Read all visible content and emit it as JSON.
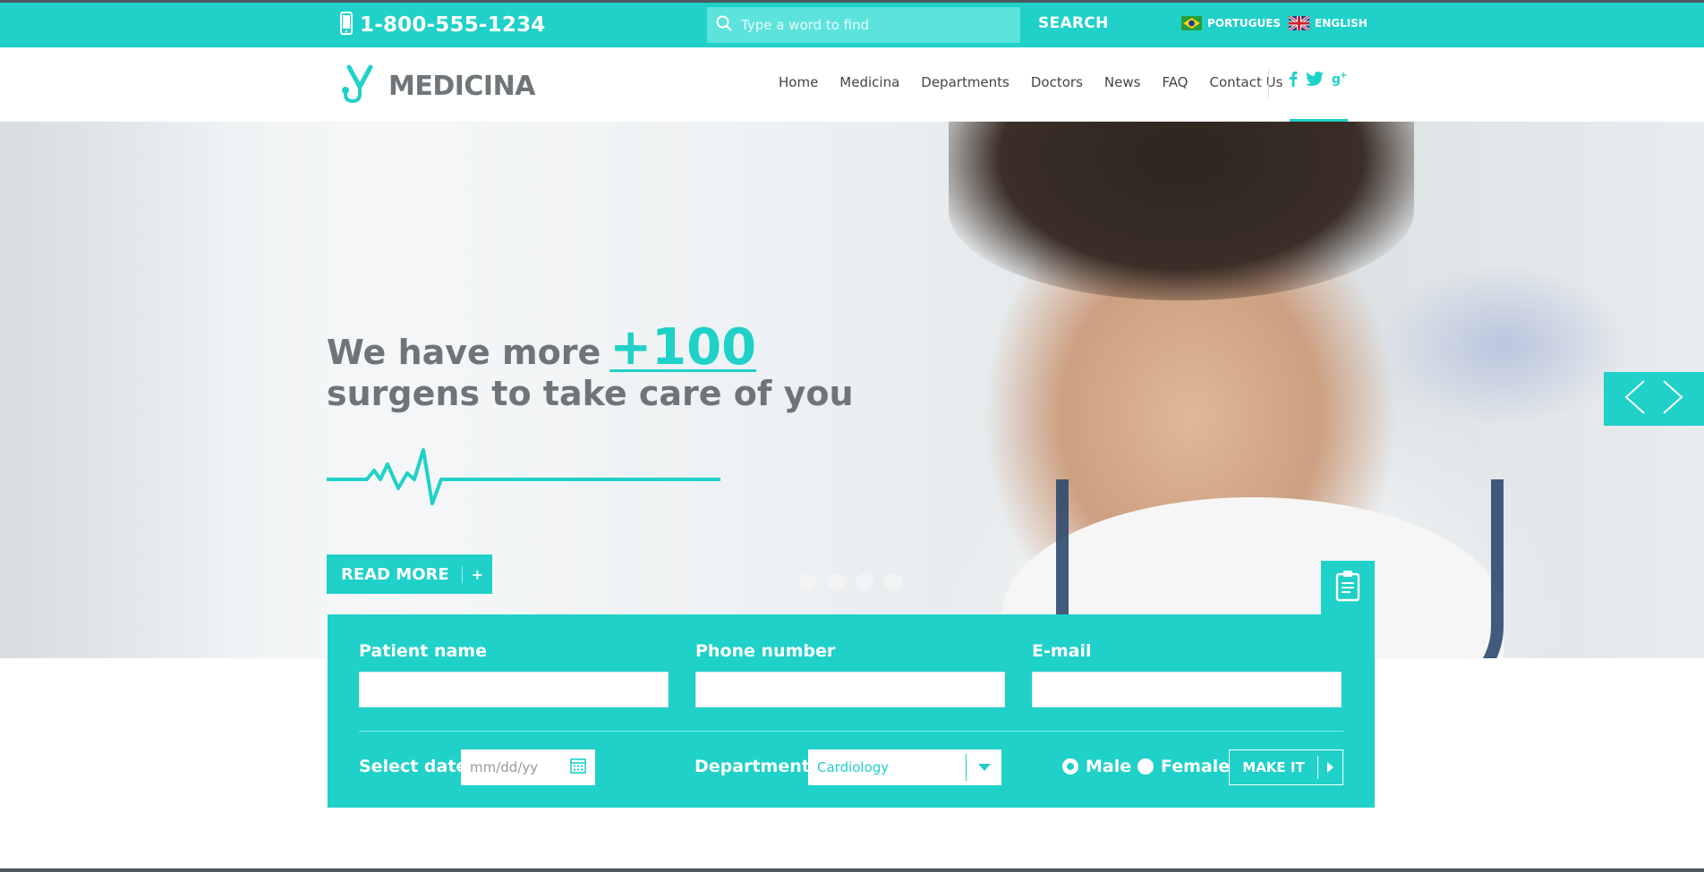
{
  "topbar": {
    "phone": "1-800-555-1234",
    "search_placeholder": "Type a word to find",
    "search_button": "SEARCH",
    "languages": [
      "PORTUGUES",
      "ENGLISH"
    ]
  },
  "header": {
    "logo": "MEDICINA",
    "nav": [
      "Home",
      "Medicina",
      "Departments",
      "Doctors",
      "News",
      "FAQ",
      "Contact Us"
    ],
    "socials": [
      "facebook-icon",
      "twitter-icon",
      "google-plus-icon"
    ]
  },
  "hero": {
    "line1_prefix": "We have more",
    "line1_highlight": "+100",
    "line2": "surgens to take care of you",
    "read_more": "READ MORE",
    "read_more_plus": "+",
    "slide_count": 4,
    "active_slide": 1
  },
  "form": {
    "patient_name": "Patient name",
    "phone_number": "Phone number",
    "email": "E-mail",
    "select_date": "Select date",
    "date_placeholder": "mm/dd/yy",
    "department_label": "Department",
    "department_value": "Cardiology",
    "gender_male": "Male",
    "gender_female": "Female",
    "gender_selected": "Male",
    "submit": "MAKE IT"
  },
  "colors": {
    "accent": "#1fd1c8",
    "text_gray": "#6f7478",
    "dark_strip": "#4b5a5e"
  }
}
